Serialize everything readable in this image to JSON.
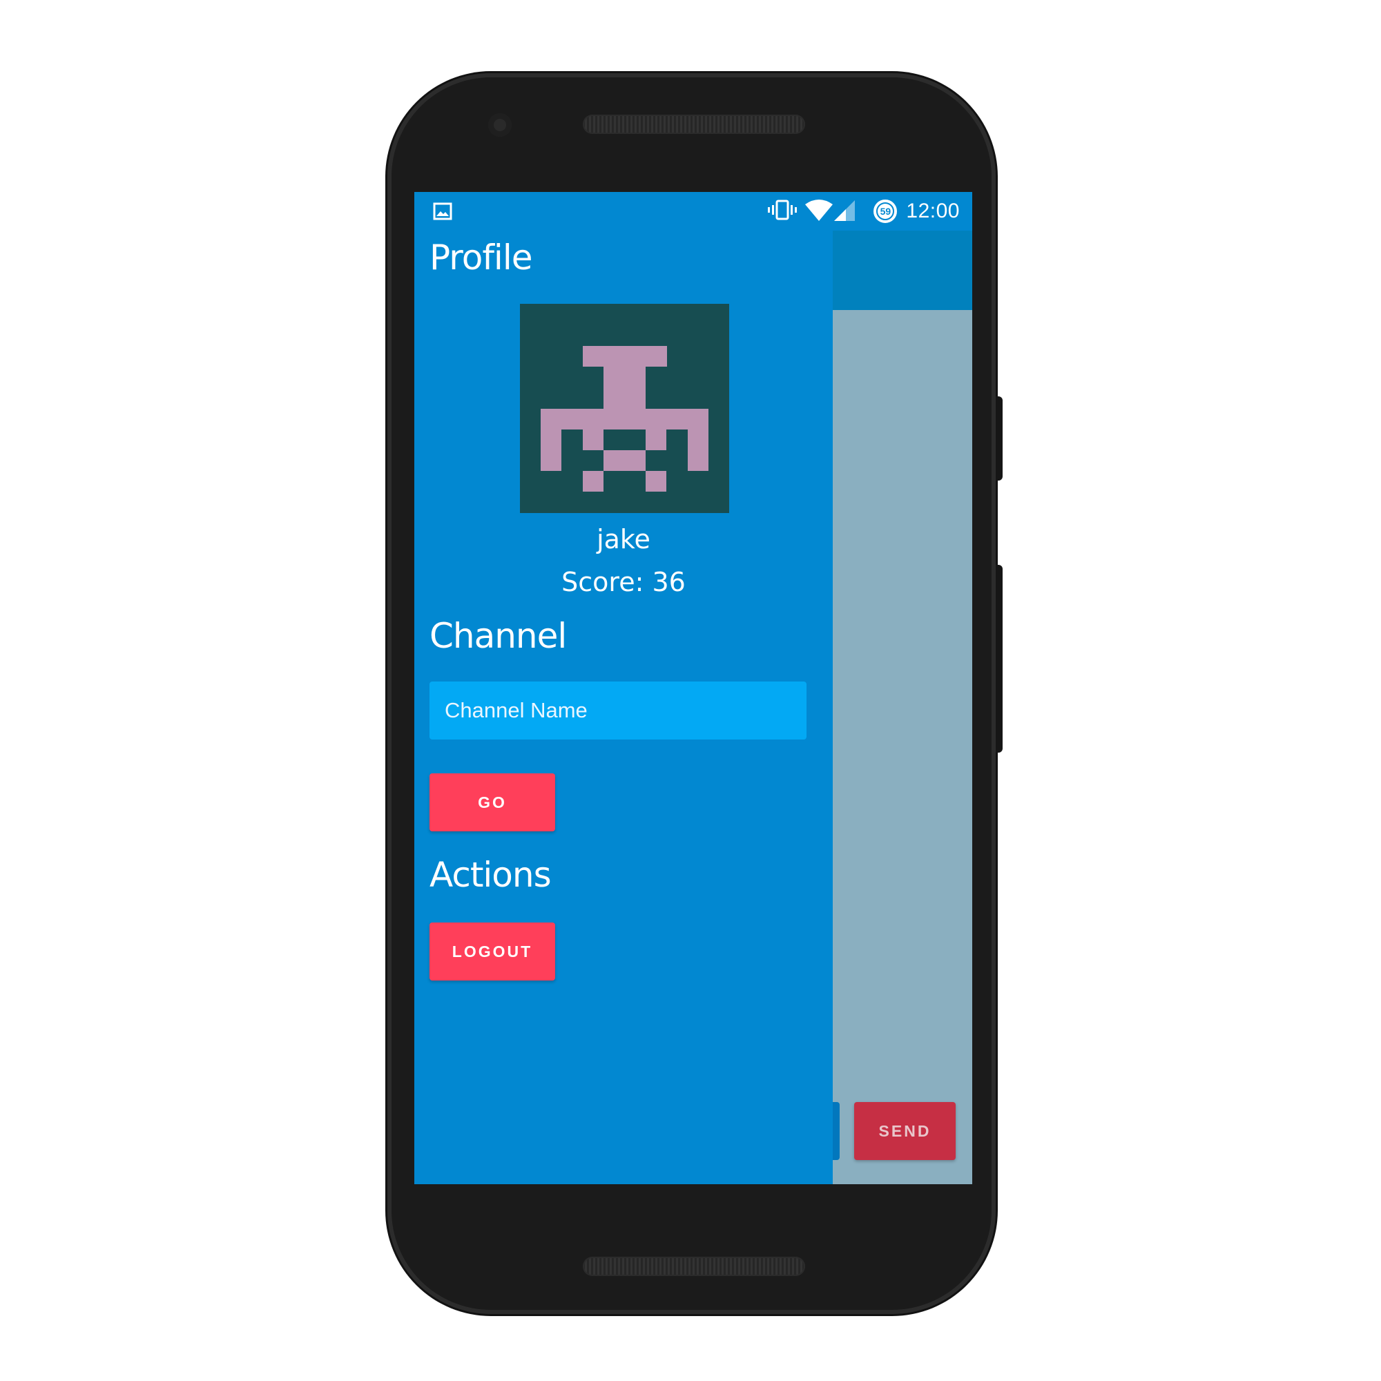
{
  "status_bar": {
    "time": "12:00",
    "battery_level": "59",
    "icons": [
      "gallery-notification-icon",
      "vibrate-icon",
      "wifi-icon",
      "cellular-signal-icon",
      "battery-saver-icon"
    ]
  },
  "drawer": {
    "profile_title": "Profile",
    "avatar": {
      "icon": "pixel-invader-avatar",
      "background_color": "#174d51",
      "pixel_color": "#bc94b3"
    },
    "username": "jake",
    "score": "Score: 36",
    "channel_title": "Channel",
    "channel_input": {
      "value": "",
      "placeholder": "Channel Name"
    },
    "go_label": "GO",
    "actions_title": "Actions",
    "logout_label": "LOGOUT"
  },
  "background": {
    "send_label": "SEND"
  },
  "colors": {
    "drawer_bg": "#0288d1",
    "input_bg": "#03a9f4",
    "button_accent": "#ff3f5a",
    "content_bg": "#8aafc0",
    "appbar_bg": "#0181bd"
  }
}
